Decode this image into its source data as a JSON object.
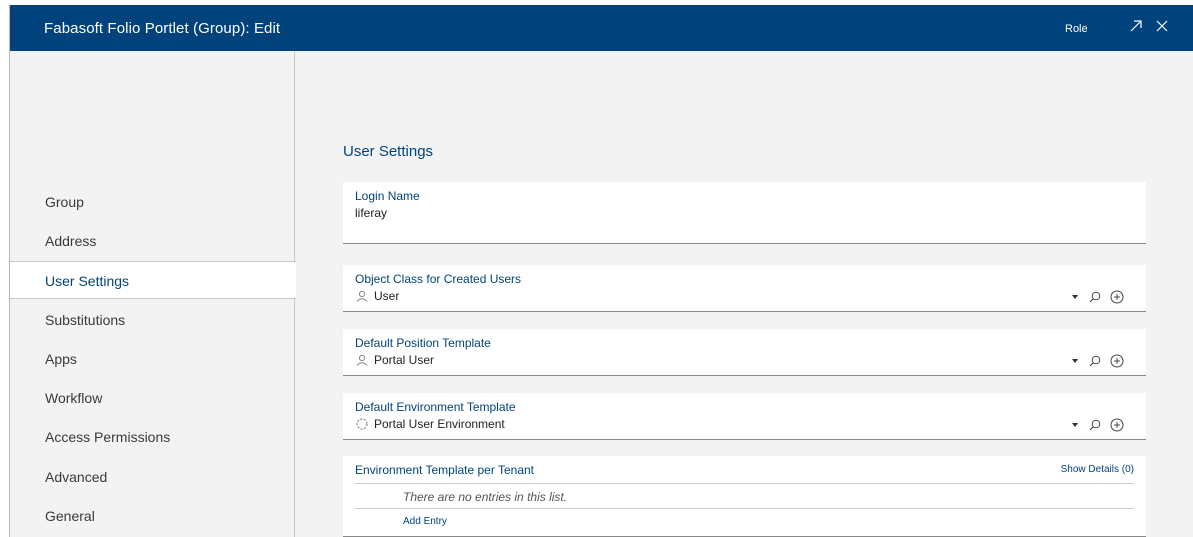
{
  "window": {
    "title": "Fabasoft Folio Portlet (Group): Edit",
    "role_label": "Role",
    "accent": "#00437c"
  },
  "sidebar": {
    "items": [
      {
        "label": "Group",
        "active": false
      },
      {
        "label": "Address",
        "active": false
      },
      {
        "label": "User Settings",
        "active": true
      },
      {
        "label": "Substitutions",
        "active": false
      },
      {
        "label": "Apps",
        "active": false
      },
      {
        "label": "Workflow",
        "active": false
      },
      {
        "label": "Access Permissions",
        "active": false
      },
      {
        "label": "Advanced",
        "active": false
      },
      {
        "label": "General",
        "active": false
      }
    ]
  },
  "main": {
    "section_title": "User Settings",
    "fields": {
      "login_name": {
        "label": "Login Name",
        "value": "liferay"
      },
      "object_class": {
        "label": "Object Class for Created Users",
        "value": "User",
        "icon": "user-icon"
      },
      "position_template": {
        "label": "Default Position Template",
        "value": "Portal User",
        "icon": "user-icon"
      },
      "environment_template": {
        "label": "Default Environment Template",
        "value": "Portal User Environment",
        "icon": "environment-icon"
      }
    },
    "tenant_list": {
      "label": "Environment Template per Tenant",
      "show_details": "Show Details (0)",
      "empty_message": "There are no entries in this list.",
      "add_entry": "Add Entry"
    }
  }
}
